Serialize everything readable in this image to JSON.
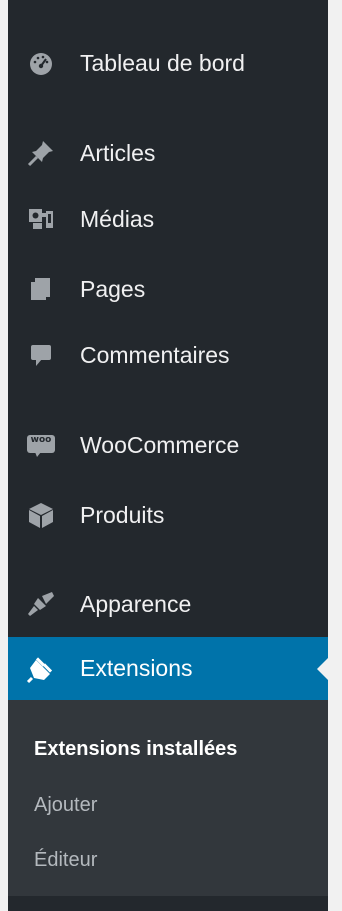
{
  "menu": {
    "items": [
      {
        "id": "dashboard",
        "label": "Tableau de bord",
        "icon": "dashboard-gauge-icon"
      },
      {
        "id": "posts",
        "label": "Articles",
        "icon": "pushpin-icon"
      },
      {
        "id": "media",
        "label": "Médias",
        "icon": "media-icon"
      },
      {
        "id": "pages",
        "label": "Pages",
        "icon": "pages-icon"
      },
      {
        "id": "comments",
        "label": "Commentaires",
        "icon": "comment-bubble-icon"
      },
      {
        "id": "woocommerce",
        "label": "WooCommerce",
        "icon": "woocommerce-icon",
        "icon_text": "woo"
      },
      {
        "id": "products",
        "label": "Produits",
        "icon": "product-box-icon"
      },
      {
        "id": "appearance",
        "label": "Apparence",
        "icon": "paintbrush-icon"
      },
      {
        "id": "plugins",
        "label": "Extensions",
        "icon": "plugin-plug-icon",
        "active": true
      }
    ],
    "submenu": [
      {
        "label": "Extensions installées",
        "current": true
      },
      {
        "label": "Ajouter"
      },
      {
        "label": "Éditeur"
      }
    ]
  },
  "colors": {
    "sidebar_bg": "#23282d",
    "submenu_bg": "#32373c",
    "active_bg": "#0073aa",
    "page_bg": "#f1f1f1",
    "icon_color": "#9ea3a8"
  }
}
